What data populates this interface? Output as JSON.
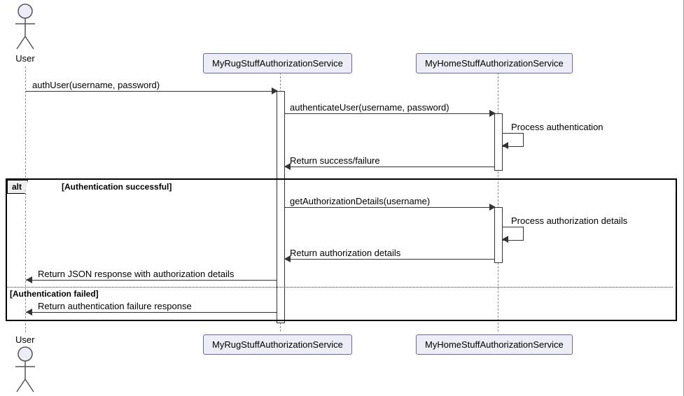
{
  "actors": {
    "user_top": "User",
    "user_bottom": "User"
  },
  "participants": {
    "rug_top": "MyRugStuffAuthorizationService",
    "home_top": "MyHomeStuffAuthorizationService",
    "rug_bottom": "MyRugStuffAuthorizationService",
    "home_bottom": "MyHomeStuffAuthorizationService"
  },
  "messages": {
    "m1": "authUser(username, password)",
    "m2": "authenticateUser(username, password)",
    "m3": "Process authentication",
    "m4": "Return success/failure",
    "m5": "getAuthorizationDetails(username)",
    "m6": "Process authorization details",
    "m7": "Return authorization details",
    "m8": "Return JSON response with authorization details",
    "m9": "Return authentication failure response"
  },
  "frame": {
    "operator": "alt",
    "guard1": "[Authentication successful]",
    "guard2": "[Authentication failed]"
  }
}
